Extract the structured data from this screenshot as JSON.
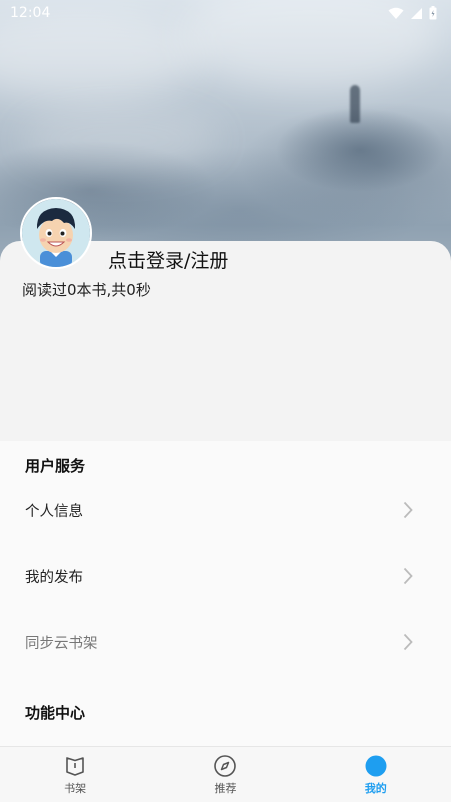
{
  "status_bar": {
    "time": "12:04"
  },
  "profile": {
    "login_prompt": "点击登录/注册",
    "read_stats": "阅读过0本书,共0秒"
  },
  "sections": {
    "user_services": {
      "title": "用户服务",
      "items": [
        {
          "label": "个人信息"
        },
        {
          "label": "我的发布"
        },
        {
          "label": "同步云书架"
        }
      ]
    },
    "function_center": {
      "title": "功能中心"
    }
  },
  "bottom_nav": {
    "items": [
      {
        "label": "书架",
        "icon": "bookshelf-icon"
      },
      {
        "label": "推荐",
        "icon": "compass-icon"
      },
      {
        "label": "我的",
        "icon": "profile-dot-icon"
      }
    ],
    "active_color": "#1e9ef0"
  }
}
